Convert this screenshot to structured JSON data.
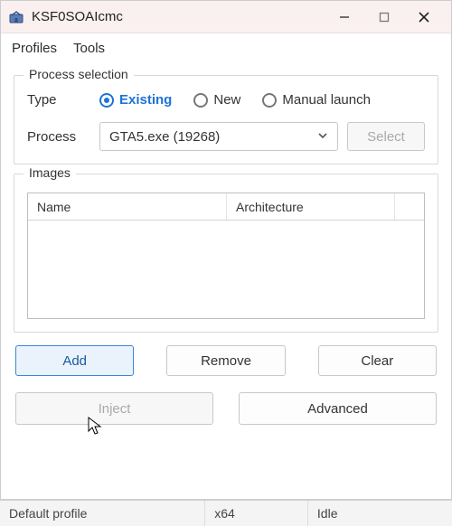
{
  "window": {
    "title": "KSF0SOAIcmc"
  },
  "menu": {
    "profiles": "Profiles",
    "tools": "Tools"
  },
  "process_selection": {
    "legend": "Process selection",
    "type_label": "Type",
    "radios": {
      "existing": "Existing",
      "new": "New",
      "manual": "Manual launch",
      "selected": "existing"
    },
    "process_label": "Process",
    "process_value": "GTA5.exe (19268)",
    "select_button": "Select"
  },
  "images": {
    "legend": "Images",
    "columns": {
      "name": "Name",
      "arch": "Architecture"
    },
    "rows": []
  },
  "buttons": {
    "add": "Add",
    "remove": "Remove",
    "clear": "Clear",
    "inject": "Inject",
    "advanced": "Advanced"
  },
  "status": {
    "profile": "Default profile",
    "arch": "x64",
    "state": "Idle"
  }
}
